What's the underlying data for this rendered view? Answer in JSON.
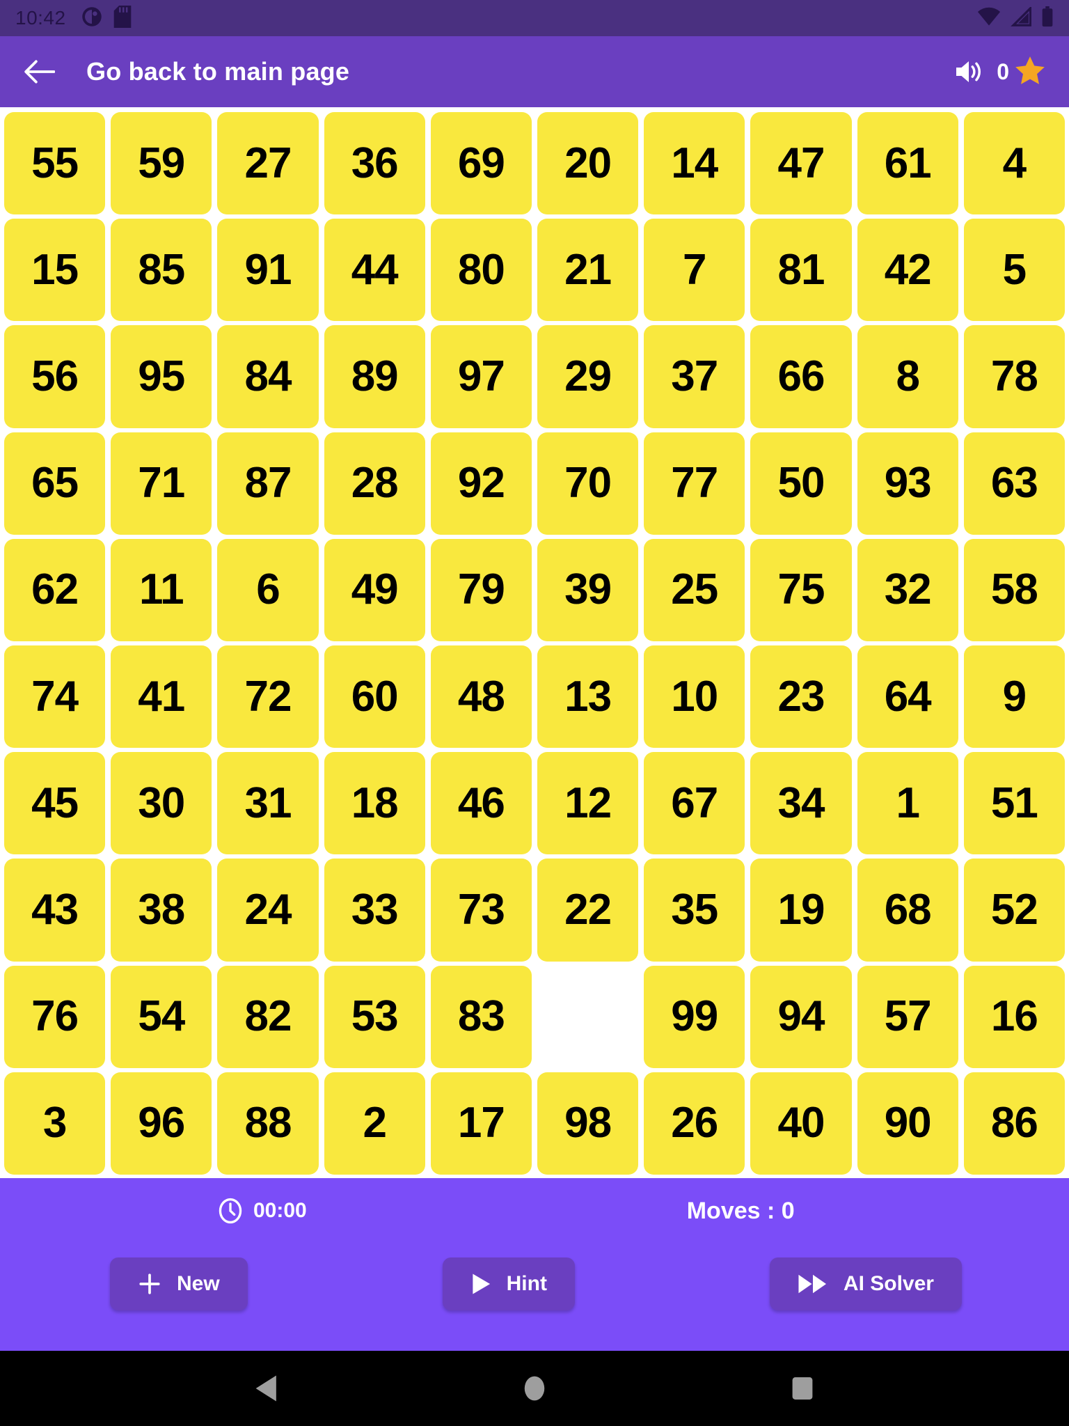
{
  "status_bar": {
    "time": "10:42",
    "left_icons": [
      "do-not-disturb-icon",
      "sd-card-icon"
    ],
    "right_icons": [
      "wifi-icon",
      "cellular-signal-icon",
      "battery-icon"
    ],
    "background_color": "#4a3080",
    "icon_color": "#241348"
  },
  "app_bar": {
    "back_label": "back-arrow",
    "title": "Go back to main page",
    "volume_icon": "volume-up-icon",
    "star_count": "0",
    "star_icon": "star-icon",
    "background_color": "#6a3fc0",
    "star_color": "#f5a623"
  },
  "board": {
    "columns": 10,
    "rows": 10,
    "tile_color": "#f9e83e",
    "tile_text_color": "#000000",
    "empty_label": "",
    "tiles": [
      [
        "55",
        "59",
        "27",
        "36",
        "69",
        "20",
        "14",
        "47",
        "61",
        "4"
      ],
      [
        "15",
        "85",
        "91",
        "44",
        "80",
        "21",
        "7",
        "81",
        "42",
        "5"
      ],
      [
        "56",
        "95",
        "84",
        "89",
        "97",
        "29",
        "37",
        "66",
        "8",
        "78"
      ],
      [
        "65",
        "71",
        "87",
        "28",
        "92",
        "70",
        "77",
        "50",
        "93",
        "63"
      ],
      [
        "62",
        "11",
        "6",
        "49",
        "79",
        "39",
        "25",
        "75",
        "32",
        "58"
      ],
      [
        "74",
        "41",
        "72",
        "60",
        "48",
        "13",
        "10",
        "23",
        "64",
        "9"
      ],
      [
        "45",
        "30",
        "31",
        "18",
        "46",
        "12",
        "67",
        "34",
        "1",
        "51"
      ],
      [
        "43",
        "38",
        "24",
        "33",
        "73",
        "22",
        "35",
        "19",
        "68",
        "52"
      ],
      [
        "76",
        "54",
        "82",
        "53",
        "83",
        "",
        "99",
        "94",
        "57",
        "16"
      ],
      [
        "3",
        "96",
        "88",
        "2",
        "17",
        "98",
        "26",
        "40",
        "90",
        "86"
      ]
    ]
  },
  "footer": {
    "background_color": "#7b4df8",
    "clock_icon": "clock-icon",
    "timer": "00:00",
    "moves": "Moves : 0",
    "buttons": [
      {
        "label": "New",
        "icon": "plus-icon"
      },
      {
        "label": "Hint",
        "icon": "play-icon"
      },
      {
        "label": "AI Solver",
        "icon": "fast-forward-icon"
      }
    ],
    "button_color": "#6a3fc0"
  },
  "nav_bar": {
    "background_color": "#000000",
    "buttons": [
      "back-triangle-icon",
      "home-circle-icon",
      "recents-square-icon"
    ]
  }
}
